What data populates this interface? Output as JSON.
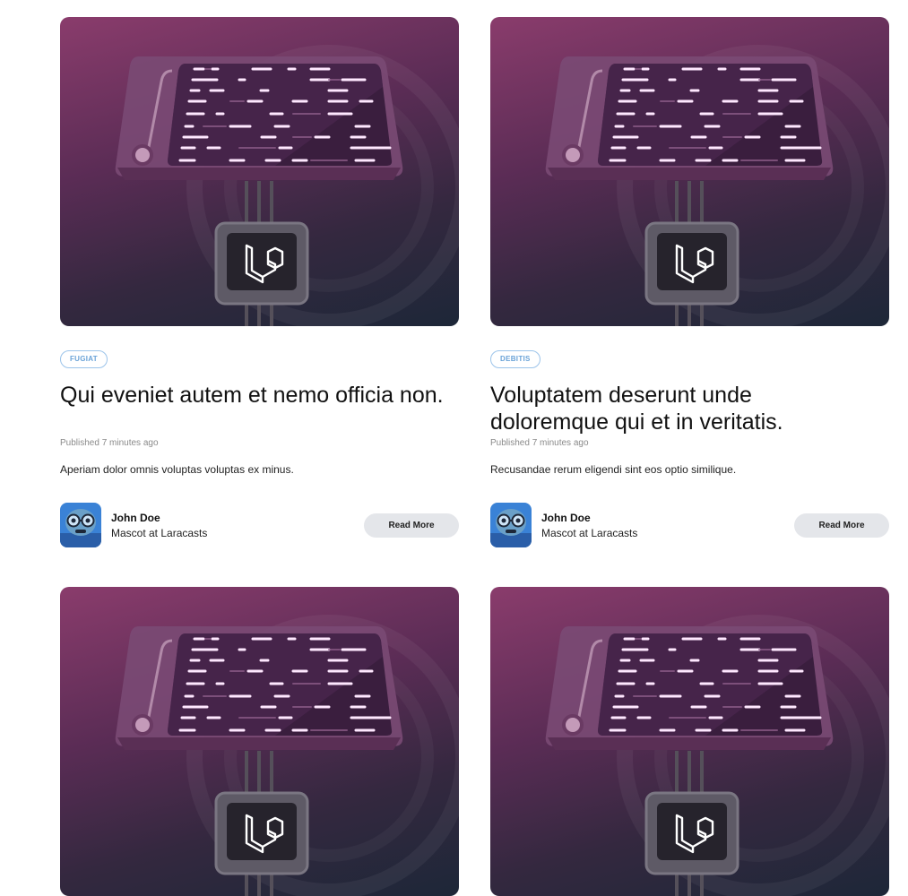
{
  "posts": [
    {
      "category": "FUGIAT",
      "title": "Qui eveniet autem et nemo officia non.",
      "published": "Published 7 minutes ago",
      "excerpt": "Aperiam dolor omnis voluptas voluptas ex minus.",
      "author_name": "John Doe",
      "author_role": "Mascot at Laracasts",
      "button_label": "Read More"
    },
    {
      "category": "DEBITIS",
      "title": "Voluptatem deserunt unde doloremque qui et in veritatis.",
      "published": "Published 7 minutes ago",
      "excerpt": "Recusandae rerum eligendi sint eos optio similique.",
      "author_name": "John Doe",
      "author_role": "Mascot at Laracasts",
      "button_label": "Read More"
    },
    {},
    {}
  ]
}
